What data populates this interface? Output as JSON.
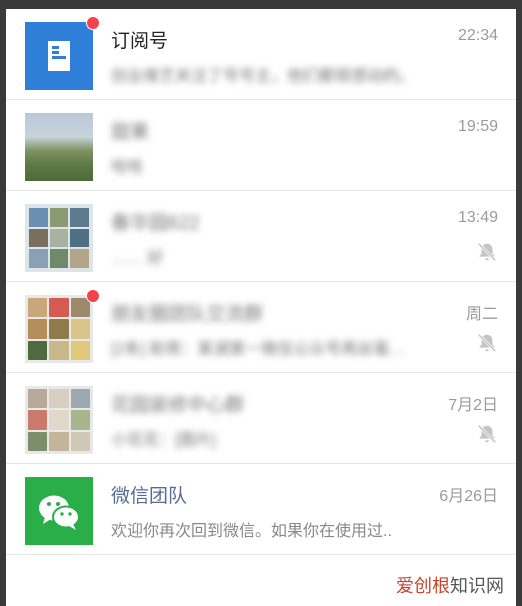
{
  "chats": [
    {
      "name": "订阅号",
      "preview": "创业维艺关注了号号主，他们都很感动的。",
      "time": "22:34",
      "unread": true,
      "muted": false,
      "avatar": "subscription-icon",
      "blurred_name": false
    },
    {
      "name": "甜果",
      "preview": "哈哈",
      "time": "19:59",
      "unread": false,
      "muted": false,
      "avatar": "landscape-photo",
      "blurred_name": true
    },
    {
      "name": "春华园622",
      "preview": "…… 好",
      "time": "13:49",
      "unread": false,
      "muted": true,
      "avatar": "group-avatar",
      "blurred_name": true
    },
    {
      "name": "朋友圈团队交流群",
      "preview": "[2条] 助哥：某湖第一微信公众号再丝毫…",
      "time": "周二",
      "unread": true,
      "muted": true,
      "avatar": "group-avatar",
      "blurred_name": true
    },
    {
      "name": "花园装修中心群",
      "preview": "小花花：[图片]",
      "time": "7月2日",
      "unread": false,
      "muted": true,
      "avatar": "group-avatar",
      "blurred_name": true
    },
    {
      "name": "微信团队",
      "preview": "欢迎你再次回到微信。如果你在使用过..",
      "time": "6月26日",
      "unread": false,
      "muted": false,
      "avatar": "wechat-logo",
      "blurred_name": false
    }
  ],
  "footer": {
    "brand": "爱创根",
    "rest": "知识网"
  },
  "colors": {
    "wechat_green": "#2aae4a",
    "subscription_blue": "#2f7fd9",
    "unread_red": "#f5424a",
    "wechat_team_name": "#576b95"
  }
}
